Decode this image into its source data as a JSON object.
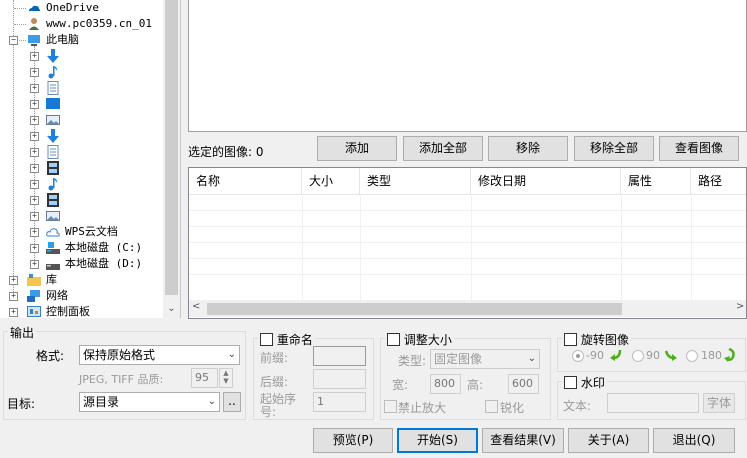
{
  "tree": {
    "items": [
      {
        "label": "OneDrive",
        "icon": "onedrive-icon"
      },
      {
        "label": "www.pc0359.cn_01",
        "icon": "user-icon"
      },
      {
        "label": "此电脑",
        "icon": "computer-icon"
      },
      {
        "label": "",
        "icon": "downloads-icon"
      },
      {
        "label": "",
        "icon": "music-icon"
      },
      {
        "label": "",
        "icon": "documents-icon"
      },
      {
        "label": "",
        "icon": "desktop-icon"
      },
      {
        "label": "",
        "icon": "pictures-icon"
      },
      {
        "label": "",
        "icon": "downloads-icon"
      },
      {
        "label": "",
        "icon": "documents-icon"
      },
      {
        "label": "",
        "icon": "videos-icon"
      },
      {
        "label": "",
        "icon": "music-icon"
      },
      {
        "label": "",
        "icon": "videos-icon"
      },
      {
        "label": "",
        "icon": "pictures-icon"
      },
      {
        "label": "WPS云文档",
        "icon": "cloud-icon"
      },
      {
        "label": "本地磁盘 (C:)",
        "icon": "drive-icon"
      },
      {
        "label": "本地磁盘 (D:)",
        "icon": "drive-icon"
      },
      {
        "label": "库",
        "icon": "library-icon"
      },
      {
        "label": "网络",
        "icon": "network-icon"
      },
      {
        "label": "控制面板",
        "icon": "control-panel-icon"
      }
    ]
  },
  "selected": {
    "label": "选定的图像:",
    "count": "0"
  },
  "toolbar": {
    "add": "添加",
    "add_all": "添加全部",
    "remove": "移除",
    "remove_all": "移除全部",
    "view": "查看图像"
  },
  "list": {
    "columns": [
      "名称",
      "大小",
      "类型",
      "修改日期",
      "属性",
      "路径"
    ]
  },
  "output": {
    "title": "输出",
    "format_label": "格式:",
    "format_value": "保持原始格式",
    "quality_label": "JPEG, TIFF 品质:",
    "quality_value": "95",
    "target_label": "目标:",
    "target_value": "源目录",
    "browse": ".."
  },
  "rename": {
    "title": "重命名",
    "prefix_label": "前缀:",
    "suffix_label": "后缀:",
    "start_label": "起始序号:",
    "start_value": "1"
  },
  "resize": {
    "title": "调整大小",
    "type_label": "类型:",
    "type_value": "固定图像",
    "width_label": "宽:",
    "width_value": "800",
    "height_label": "高:",
    "height_value": "600",
    "no_enlarge": "禁止放大",
    "sharpen": "锐化"
  },
  "rotate": {
    "title": "旋转图像",
    "options": [
      "-90",
      "90",
      "180"
    ]
  },
  "watermark": {
    "title": "水印",
    "text_label": "文本:",
    "font_button": "字体"
  },
  "actions": {
    "preview": "预览(P)",
    "start": "开始(S)",
    "results": "查看结果(V)",
    "about": "关于(A)",
    "exit": "退出(Q)"
  },
  "colors": {
    "accent": "#0078d7",
    "rotate_arrow": "#4caf1a"
  }
}
